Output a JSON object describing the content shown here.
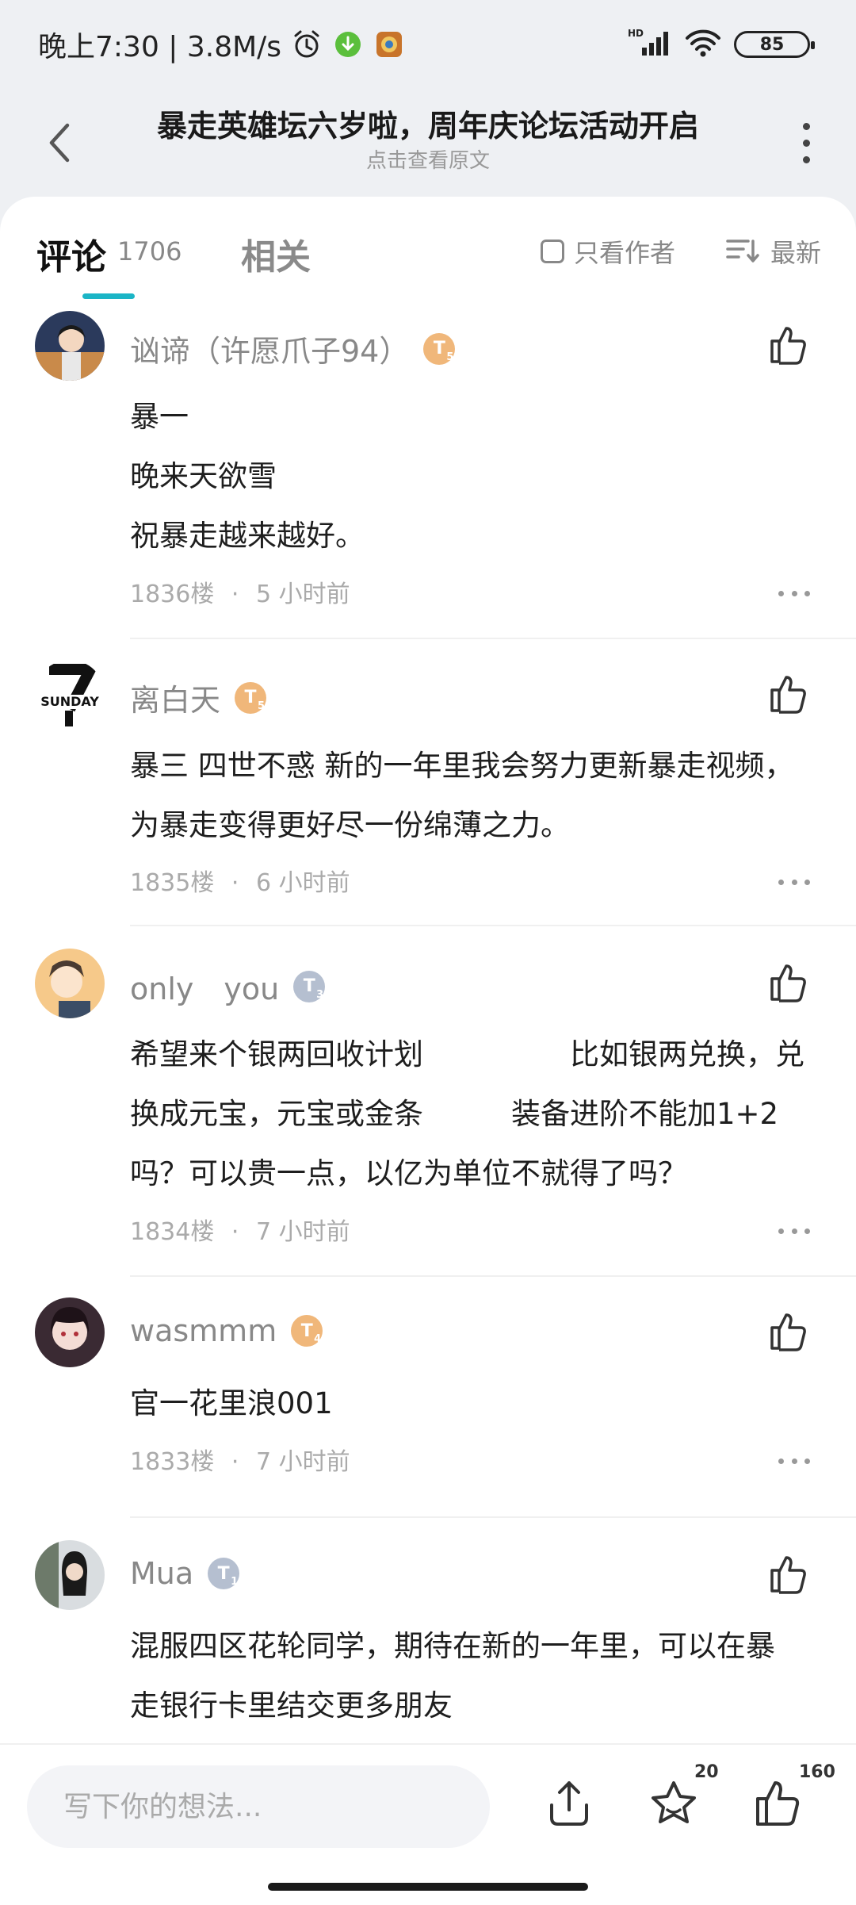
{
  "status_bar": {
    "time_speed": "晚上7:30 | 3.8M/s",
    "network": "HD",
    "battery": "85",
    "icons": [
      "alarm-icon",
      "download-icon",
      "app-icon",
      "signal-icon",
      "wifi-icon",
      "battery-icon"
    ]
  },
  "header": {
    "title": "暴走英雄坛六岁啦，周年庆论坛活动开启",
    "subtitle": "点击查看原文"
  },
  "tabs": {
    "comments_label": "评论",
    "comments_count": "1706",
    "related_label": "相关",
    "only_author_label": "只看作者",
    "sort_label": "最新",
    "accent_color": "#1bb5c6"
  },
  "comments": [
    {
      "author": "讻谛（许愿爪子94）",
      "level": "T",
      "level_num": "5",
      "lines": [
        "暴一",
        "晚来天欲雪",
        "祝暴走越来越好。"
      ],
      "floor": "1836楼",
      "sep": "·",
      "time": "5 小时前"
    },
    {
      "author": "离白天",
      "level": "T",
      "level_num": "5",
      "lines": [
        "暴三 四世不惑 新的一年里我会努力更新暴走视频，",
        "为暴走变得更好尽一份绵薄之力。"
      ],
      "floor": "1835楼",
      "sep": "·",
      "time": "6 小时前",
      "avatar_text": "SUNDAY"
    },
    {
      "author": "only　you",
      "level": "T",
      "level_num": "3",
      "lines": [
        "希望来个银两回收计划　　　　　比如银两兑换，兑",
        "换成元宝，元宝或金条　　　装备进阶不能加1+2",
        "吗？可以贵一点，以亿为单位不就得了吗？"
      ],
      "floor": "1834楼",
      "sep": "·",
      "time": "7 小时前"
    },
    {
      "author": "wasmmm",
      "level": "T",
      "level_num": "4",
      "lines": [
        "官一花里浪001"
      ],
      "floor": "1833楼",
      "sep": "·",
      "time": "7 小时前"
    },
    {
      "author": "Mua",
      "level": "T",
      "level_num": "1",
      "lines": [
        "混服四区花轮同学，期待在新的一年里，可以在暴",
        "走银行卡里结交更多朋友"
      ]
    }
  ],
  "bottom_bar": {
    "input_placeholder": "写下你的想法...",
    "favorite_count": "20",
    "like_count": "160"
  }
}
